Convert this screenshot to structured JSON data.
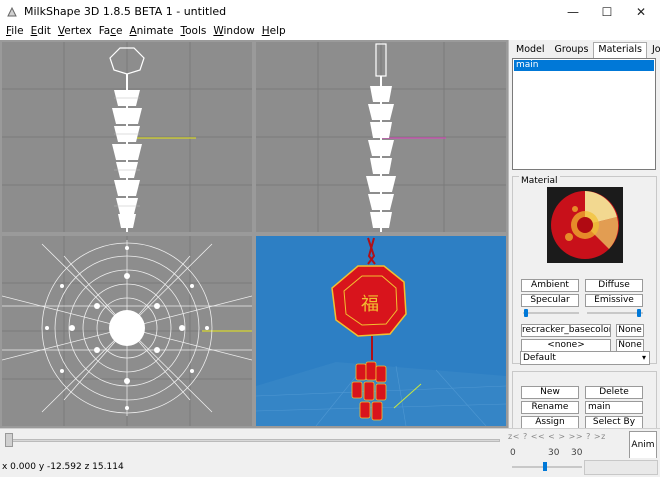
{
  "window": {
    "title": "MilkShape 3D 1.8.5 BETA 1 - untitled",
    "minimize_glyph": "—",
    "maximize_glyph": "☐",
    "close_glyph": "✕"
  },
  "menu": [
    {
      "label": "File",
      "underline": "F",
      "rest": "ile"
    },
    {
      "label": "Edit",
      "underline": "E",
      "rest": "dit"
    },
    {
      "label": "Vertex",
      "underline": "V",
      "rest": "ertex"
    },
    {
      "label": "Face",
      "pre": "Fa",
      "underline": "c",
      "rest": "e"
    },
    {
      "label": "Animate",
      "underline": "A",
      "rest": "nimate"
    },
    {
      "label": "Tools",
      "underline": "T",
      "rest": "ools"
    },
    {
      "label": "Window",
      "underline": "W",
      "rest": "indow"
    },
    {
      "label": "Help",
      "underline": "H",
      "rest": "elp"
    }
  ],
  "panel": {
    "tabs": [
      "Model",
      "Groups",
      "Materials",
      "Joints"
    ],
    "active_tab": "Materials",
    "material_list": [
      "main"
    ],
    "material_group_label": "Material",
    "ambient_label": "Ambient",
    "diffuse_label": "Diffuse",
    "specular_label": "Specular",
    "emissive_label": "Emissive",
    "texture_name": "recracker_basecolor.bm",
    "texture_none_label": "None",
    "alpha_name": "<none>",
    "alpha_none_label": "None",
    "mode_value": "Default",
    "new_label": "New",
    "delete_label": "Delete",
    "rename_label": "Rename",
    "rename_value": "main",
    "assign_label": "Assign",
    "select_by_label": "Select By"
  },
  "anim": {
    "nav_text": "z<  ?  <<  <  >  >>  ?  >z",
    "start_frame": "0",
    "end_frame_a": "30",
    "end_frame_b": "30",
    "anim_label": "Anim"
  },
  "status": {
    "coords": "x 0.000 y -12.592 z 15.114"
  },
  "colors": {
    "viewport_grey": "#8d8d8d",
    "perspective_bg": "#2d7fc4",
    "selection_blue": "#0078d7",
    "lantern_red": "#d8141c",
    "gold": "#f2c030"
  }
}
